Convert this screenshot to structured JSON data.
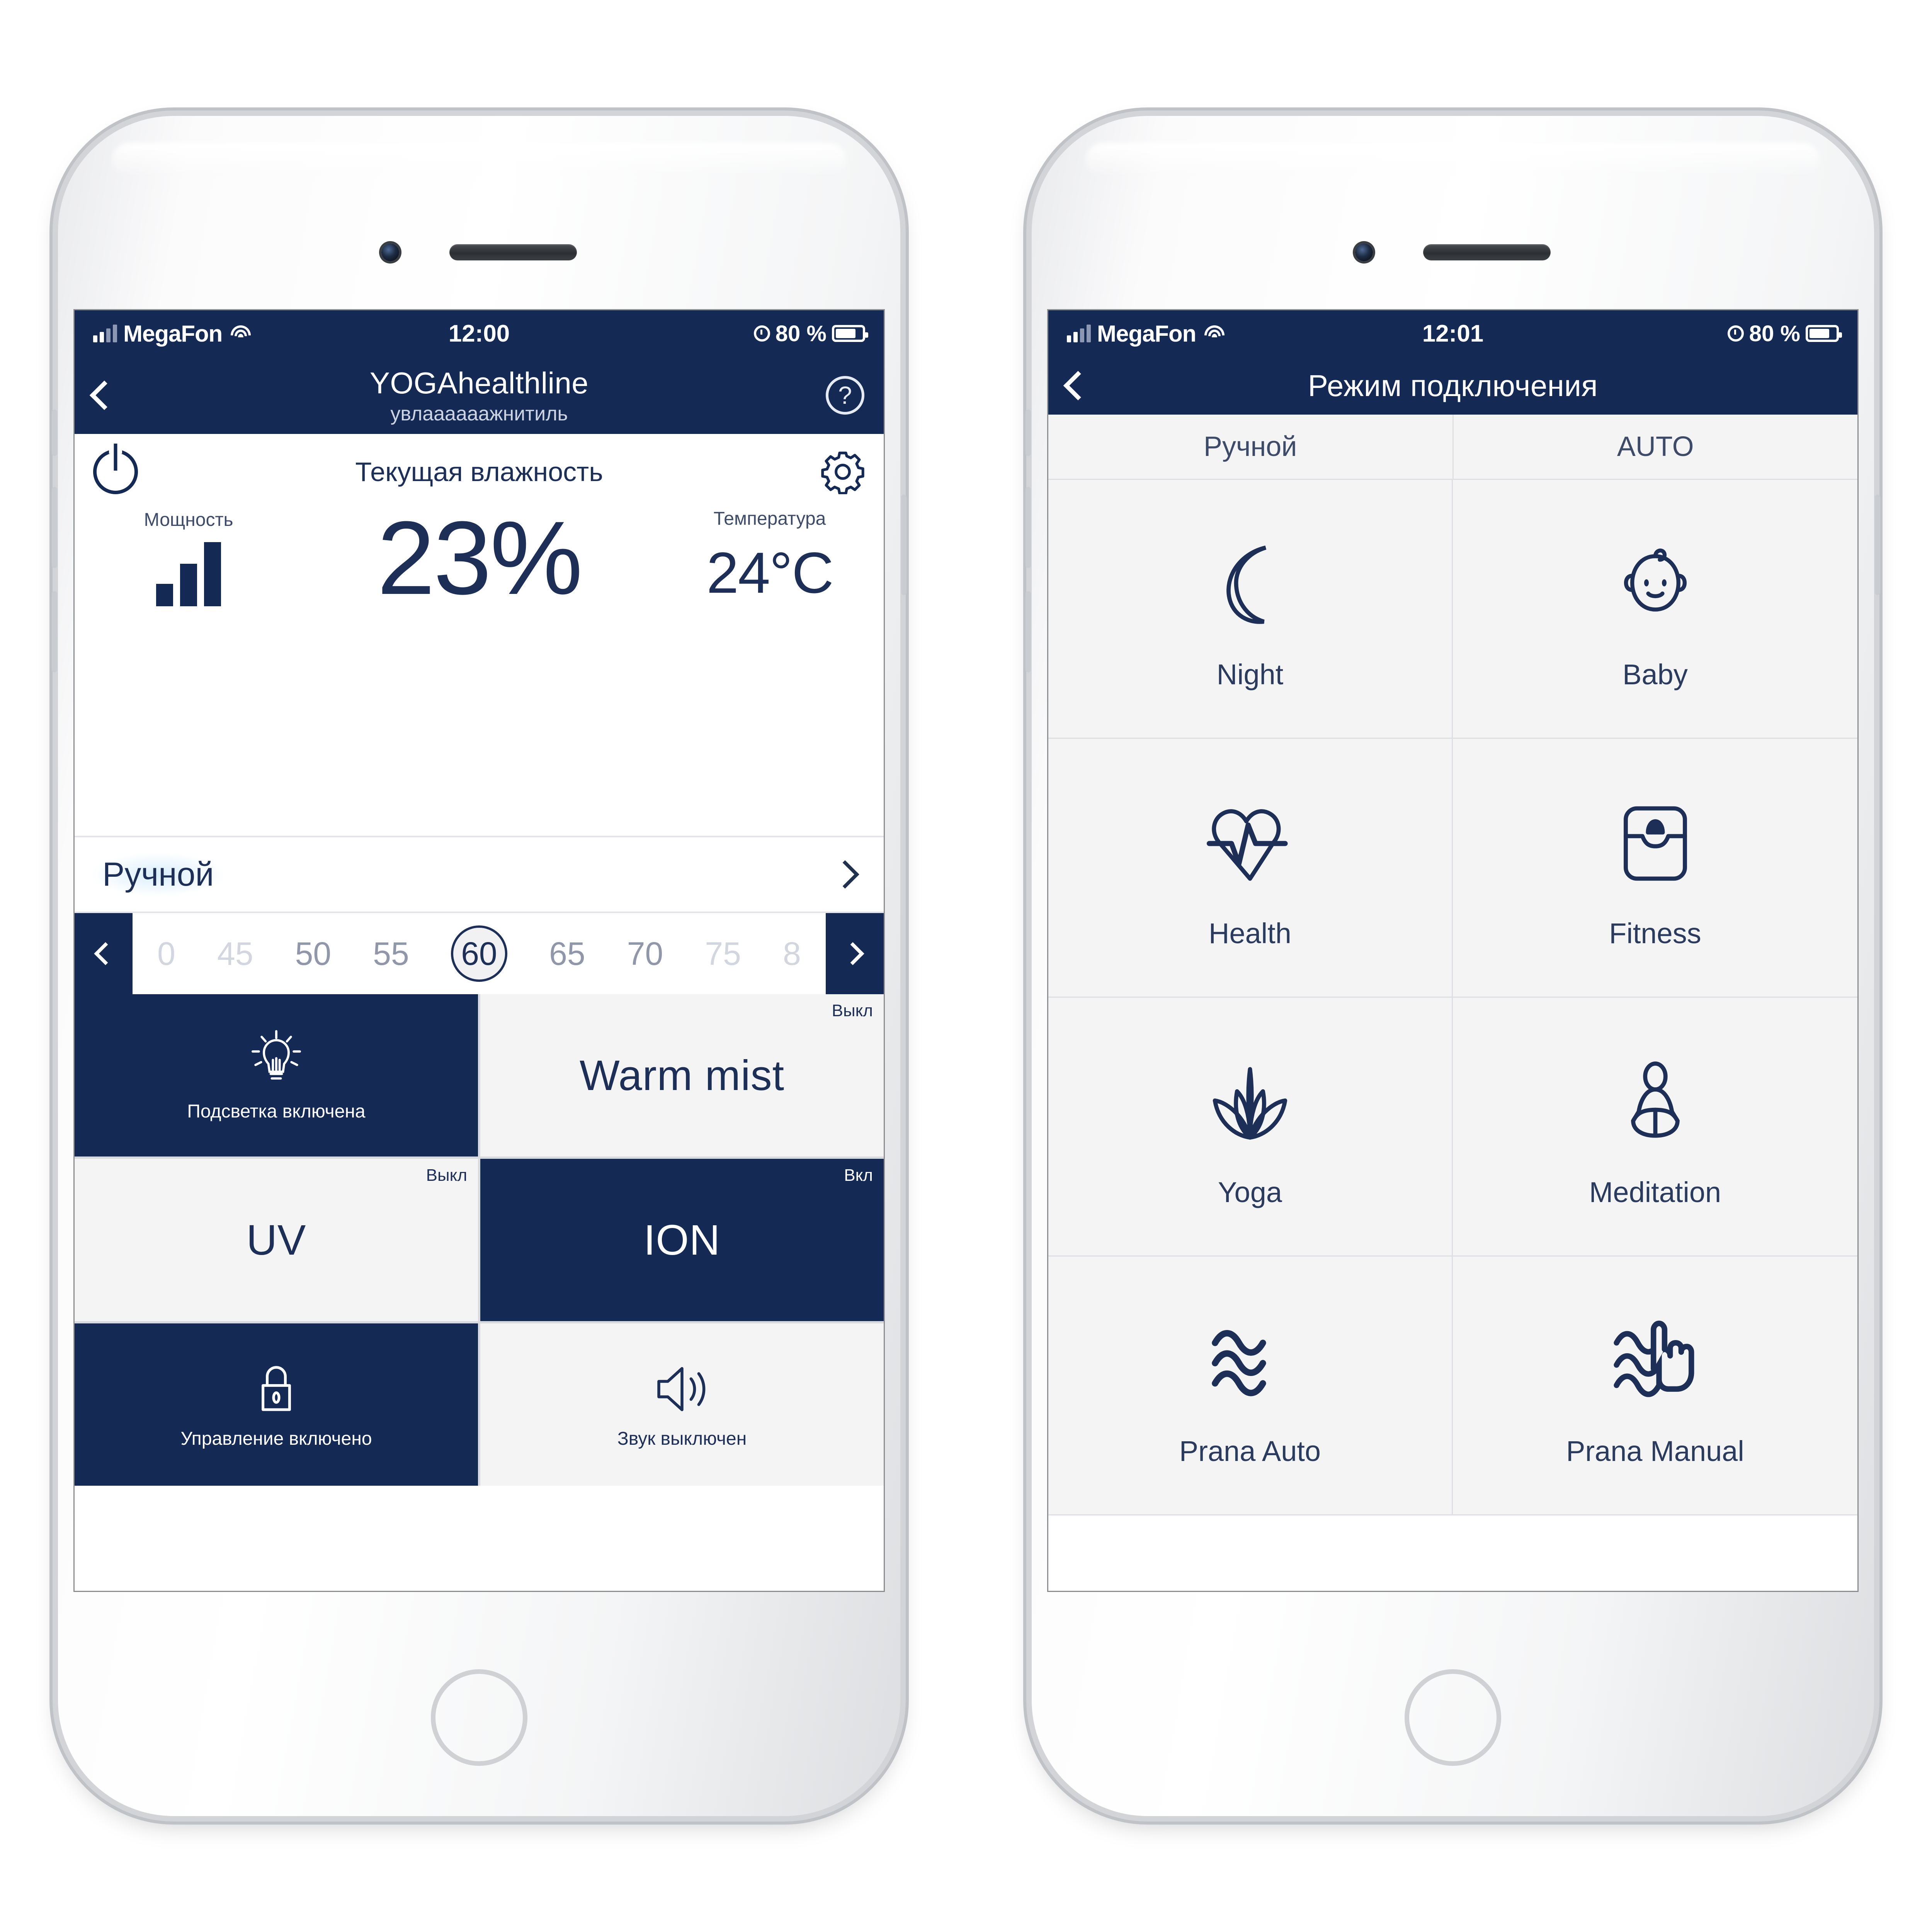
{
  "brand": {
    "navy": "#142a55",
    "ink": "#1d2f57",
    "tile_light": "#f4f4f5"
  },
  "phone_left": {
    "status_bar": {
      "carrier": "MegaFon",
      "time": "12:00",
      "battery_text": "80 %",
      "signal_icon": "cellular-signal-icon",
      "wifi_icon": "wifi-icon",
      "alarm_icon": "alarm-clock-icon",
      "battery_icon": "battery-icon"
    },
    "nav": {
      "back_icon": "back-chevron-icon",
      "title": "YOGAhealthline",
      "subtitle": "увлаааааажнитиль",
      "help_label": "?"
    },
    "main": {
      "power_icon": "power-icon",
      "settings_icon": "gear-icon",
      "panel_title": "Текущая влажность",
      "power_label": "Мощность",
      "power_level_icon": "signal-bars-icon",
      "humidity_value": "23%",
      "temperature_label": "Температура",
      "temperature_value": "24°C"
    },
    "mode_row": {
      "label": "Ручной",
      "chevron_icon": "chevron-right-icon"
    },
    "slider": {
      "prev_icon": "chevron-left-icon",
      "next_icon": "chevron-right-icon",
      "ticks": [
        "0",
        "45",
        "50",
        "55",
        "60",
        "65",
        "70",
        "75",
        "8"
      ],
      "selected": "60"
    },
    "tiles": [
      {
        "id": "backlight",
        "state_label": "",
        "icon": "lightbulb-icon",
        "label": "Подсветка включена",
        "style": "dark",
        "kind": "icon"
      },
      {
        "id": "warm-mist",
        "state_label": "Выкл",
        "icon": "",
        "label": "Warm mist",
        "style": "light",
        "kind": "text"
      },
      {
        "id": "uv",
        "state_label": "Выкл",
        "icon": "",
        "label": "UV",
        "style": "light",
        "kind": "text"
      },
      {
        "id": "ion",
        "state_label": "Вкл",
        "icon": "",
        "label": "ION",
        "style": "dark",
        "kind": "text"
      },
      {
        "id": "child-lock",
        "state_label": "",
        "icon": "lock-icon",
        "label": "Управление включено",
        "style": "dark",
        "kind": "icon"
      },
      {
        "id": "sound",
        "state_label": "",
        "icon": "speaker-icon",
        "label": "Звук выключен",
        "style": "light",
        "kind": "icon"
      }
    ]
  },
  "phone_right": {
    "status_bar": {
      "carrier": "MegaFon",
      "time": "12:01",
      "battery_text": "80 %",
      "signal_icon": "cellular-signal-icon",
      "wifi_icon": "wifi-icon",
      "alarm_icon": "alarm-clock-icon",
      "battery_icon": "battery-icon"
    },
    "nav": {
      "back_icon": "back-chevron-icon",
      "title": "Режим подключения"
    },
    "tabs": [
      {
        "label": "Ручной"
      },
      {
        "label": "AUTO"
      }
    ],
    "modes": [
      {
        "label": "Night",
        "icon": "moon-icon"
      },
      {
        "label": "Baby",
        "icon": "baby-face-icon"
      },
      {
        "label": "Health",
        "icon": "heart-pulse-icon"
      },
      {
        "label": "Fitness",
        "icon": "scales-icon"
      },
      {
        "label": "Yoga",
        "icon": "lotus-icon"
      },
      {
        "label": "Meditation",
        "icon": "meditation-person-icon"
      },
      {
        "label": "Prana Auto",
        "icon": "waves-icon"
      },
      {
        "label": "Prana Manual",
        "icon": "hand-waves-icon"
      }
    ]
  }
}
